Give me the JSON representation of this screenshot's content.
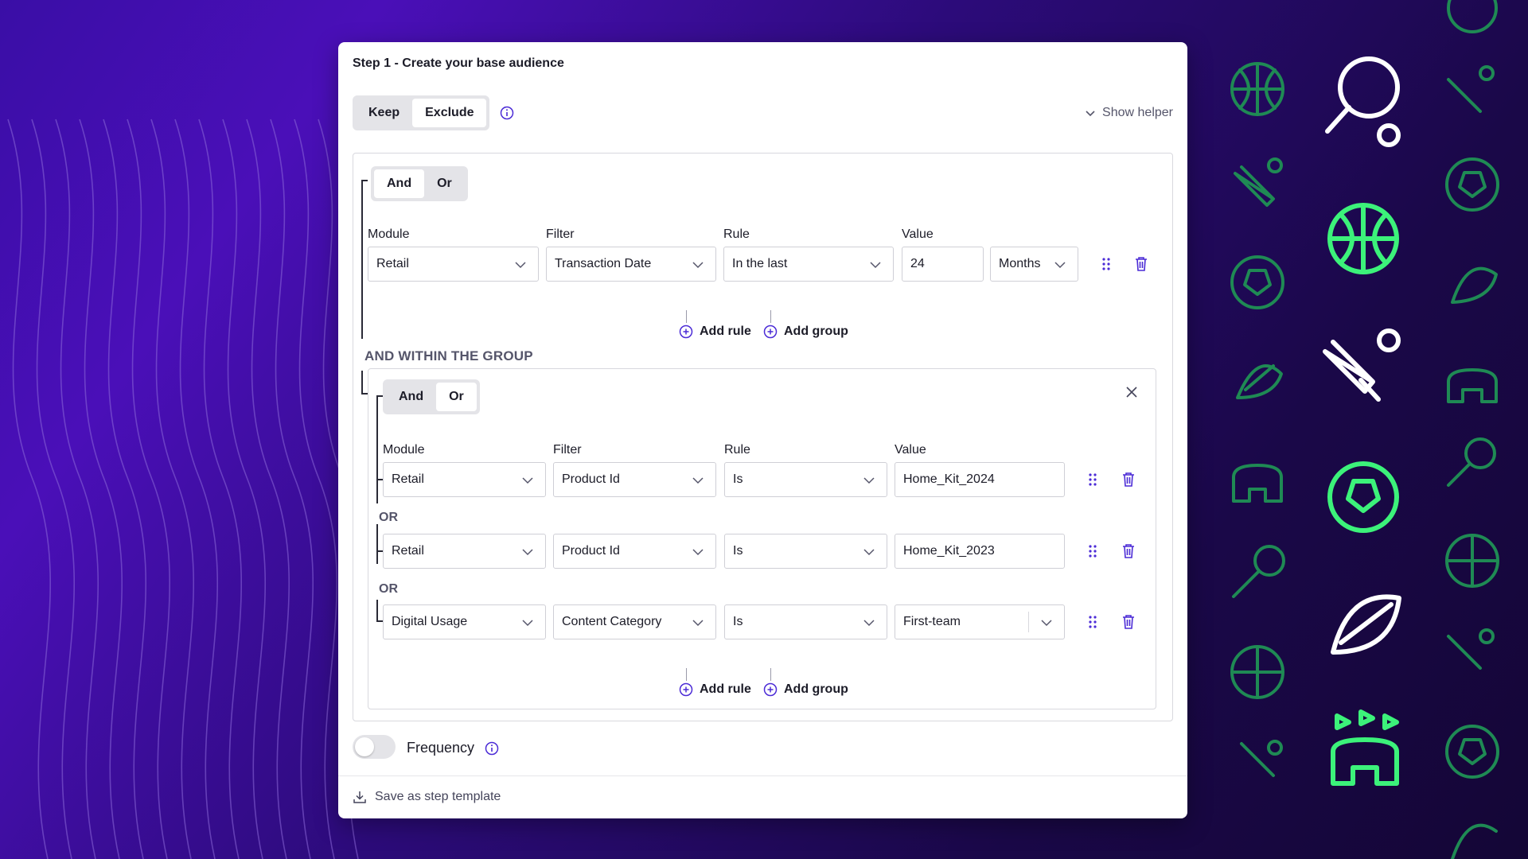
{
  "panel": {
    "title": "Step 1 - Create your base audience"
  },
  "mode_toggle": {
    "options": [
      "Keep",
      "Exclude"
    ],
    "selected": "Exclude"
  },
  "show_helper_label": "Show helper",
  "top_group": {
    "logic_options": [
      "And",
      "Or"
    ],
    "logic_selected": "And",
    "column_labels": [
      "Module",
      "Filter",
      "Rule",
      "Value"
    ],
    "rule": {
      "module": "Retail",
      "filter": "Transaction Date",
      "rule": "In the last",
      "value": "24",
      "unit": "Months"
    },
    "add_rule_label": "Add rule",
    "add_group_label": "Add group"
  },
  "within_group_label": "AND WITHIN THE GROUP",
  "nested_group": {
    "logic_options": [
      "And",
      "Or"
    ],
    "logic_selected": "Or",
    "column_labels": [
      "Module",
      "Filter",
      "Rule",
      "Value"
    ],
    "or_label": "OR",
    "rules": [
      {
        "module": "Retail",
        "filter": "Product Id",
        "rule": "Is",
        "value": "Home_Kit_2024"
      },
      {
        "module": "Retail",
        "filter": "Product Id",
        "rule": "Is",
        "value": "Home_Kit_2023"
      },
      {
        "module": "Digital Usage",
        "filter": "Content Category",
        "rule": "Is",
        "value": "First-team"
      }
    ],
    "add_rule_label": "Add rule",
    "add_group_label": "Add group"
  },
  "frequency_label": "Frequency",
  "frequency_enabled": false,
  "save_template_label": "Save as step template",
  "colors": {
    "accent": "#4b2bd6",
    "neon_green": "#3cf27a",
    "dim_green": "#1f8a54"
  }
}
